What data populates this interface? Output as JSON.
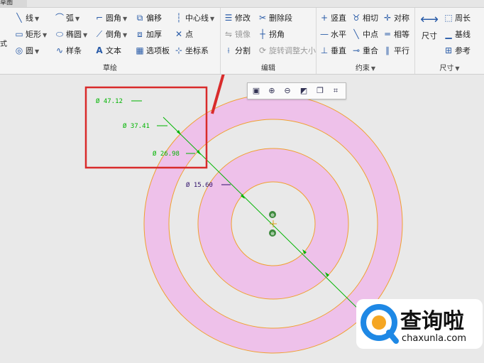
{
  "tab": {
    "label": "草图"
  },
  "groups": {
    "sketch": {
      "label": "草绘",
      "col1": [
        "线",
        "矩形",
        "圆"
      ],
      "col2": [
        "弧",
        "椭圆",
        "样条"
      ],
      "col3": [
        "圆角",
        "倒角",
        "文本"
      ],
      "col4": [
        "偏移",
        "加厚",
        "选项板"
      ],
      "col5": [
        "中心线",
        "点",
        "坐标系"
      ]
    },
    "edit": {
      "label": "编辑",
      "items": [
        "修改",
        "删除段",
        "镜像",
        "拐角",
        "分割",
        "旋转调整大小"
      ]
    },
    "constrain": {
      "label": "约束",
      "items": [
        "竖直",
        "相切",
        "对称",
        "水平",
        "中点",
        "相等",
        "垂直",
        "重合",
        "平行"
      ]
    },
    "dimension": {
      "label": "尺寸",
      "big": "尺寸",
      "items": [
        "周长",
        "基线",
        "参考"
      ]
    }
  },
  "dimensions": [
    "Ø 47.12",
    "Ø 37.41",
    "Ø 26.98",
    "Ø 15.60"
  ],
  "colors": {
    "ring_fill": "#eec1ea",
    "ring_stroke": "#f0a030",
    "dim_green": "#00b400",
    "dim_selected": "#30106a",
    "highlight": "#d92b2b"
  },
  "watermark": {
    "title": "查询啦",
    "url": "chaxunla.com"
  }
}
